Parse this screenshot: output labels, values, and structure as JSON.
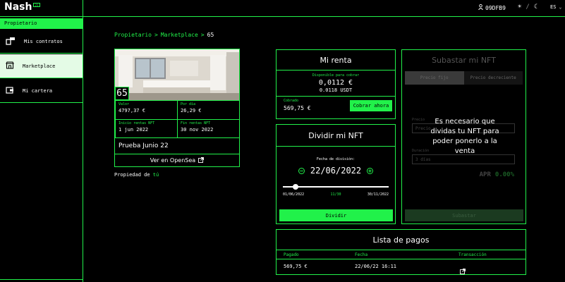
{
  "header": {
    "logo": "Nash",
    "logo_badge": "21",
    "user_id": "09DFB9",
    "language": "ES"
  },
  "sidebar": {
    "title": "Propietario",
    "items": [
      {
        "label": "Mis contratos",
        "active": false
      },
      {
        "label": "Marketplace",
        "active": true
      },
      {
        "label": "Mi cartera",
        "active": false
      }
    ]
  },
  "breadcrumb": [
    "Propietario",
    ">",
    "Marketplace",
    ">",
    "65"
  ],
  "property": {
    "id": "65",
    "valor_label": "Valor",
    "valor": "4797,37 €",
    "por_dia_label": "Por día",
    "por_dia": "26,29 €",
    "inicio_label": "Inicio rentas NFT",
    "inicio": "1 jun 2022",
    "fin_label": "Fin rentas NFT",
    "fin": "30 nov 2022",
    "name": "Prueba Junio 22",
    "opensea_label": "Ver en OpenSea",
    "owner_prefix": "Propiedad de",
    "owner": "tú"
  },
  "mi_renta": {
    "title": "Mi renta",
    "disponible_label": "Disponible para cobrar",
    "disponible_eur": "0,0112 €",
    "disponible_usdt": "0.0118 USDT",
    "cobrado_label": "Cobrado",
    "cobrado": "569,75 €",
    "cobrar_button": "Cobrar ahora"
  },
  "dividir": {
    "title": "Dividir mi NFT",
    "fecha_label": "Fecha de división:",
    "fecha": "22/06/2022",
    "start": "01/06/2022",
    "mid": "11/30",
    "end": "30/11/2022",
    "slider_fraction": 0.12,
    "button": "Dividir"
  },
  "subastar": {
    "title": "Subastar mi NFT",
    "tab_fijo": "Precio fijo",
    "tab_decreciente": "Precio decreciente",
    "precio_label": "Precio",
    "precio_placeholder": "Precio",
    "duracion_label": "Duración",
    "duracion_value": "3 días",
    "apr_label": "APR",
    "apr_value": "0.00%",
    "button": "Subastar",
    "overlay_message": "Es necesario que dividas tu NFT para poder ponerlo a la venta"
  },
  "pagos": {
    "title": "Lista de pagos",
    "headers": [
      "Pagado",
      "Fecha",
      "Transacción"
    ],
    "rows": [
      {
        "pagado": "569,75 €",
        "fecha": "22/06/22 16:11"
      }
    ]
  },
  "colors": {
    "accent": "#21f14a",
    "background": "#000000"
  }
}
